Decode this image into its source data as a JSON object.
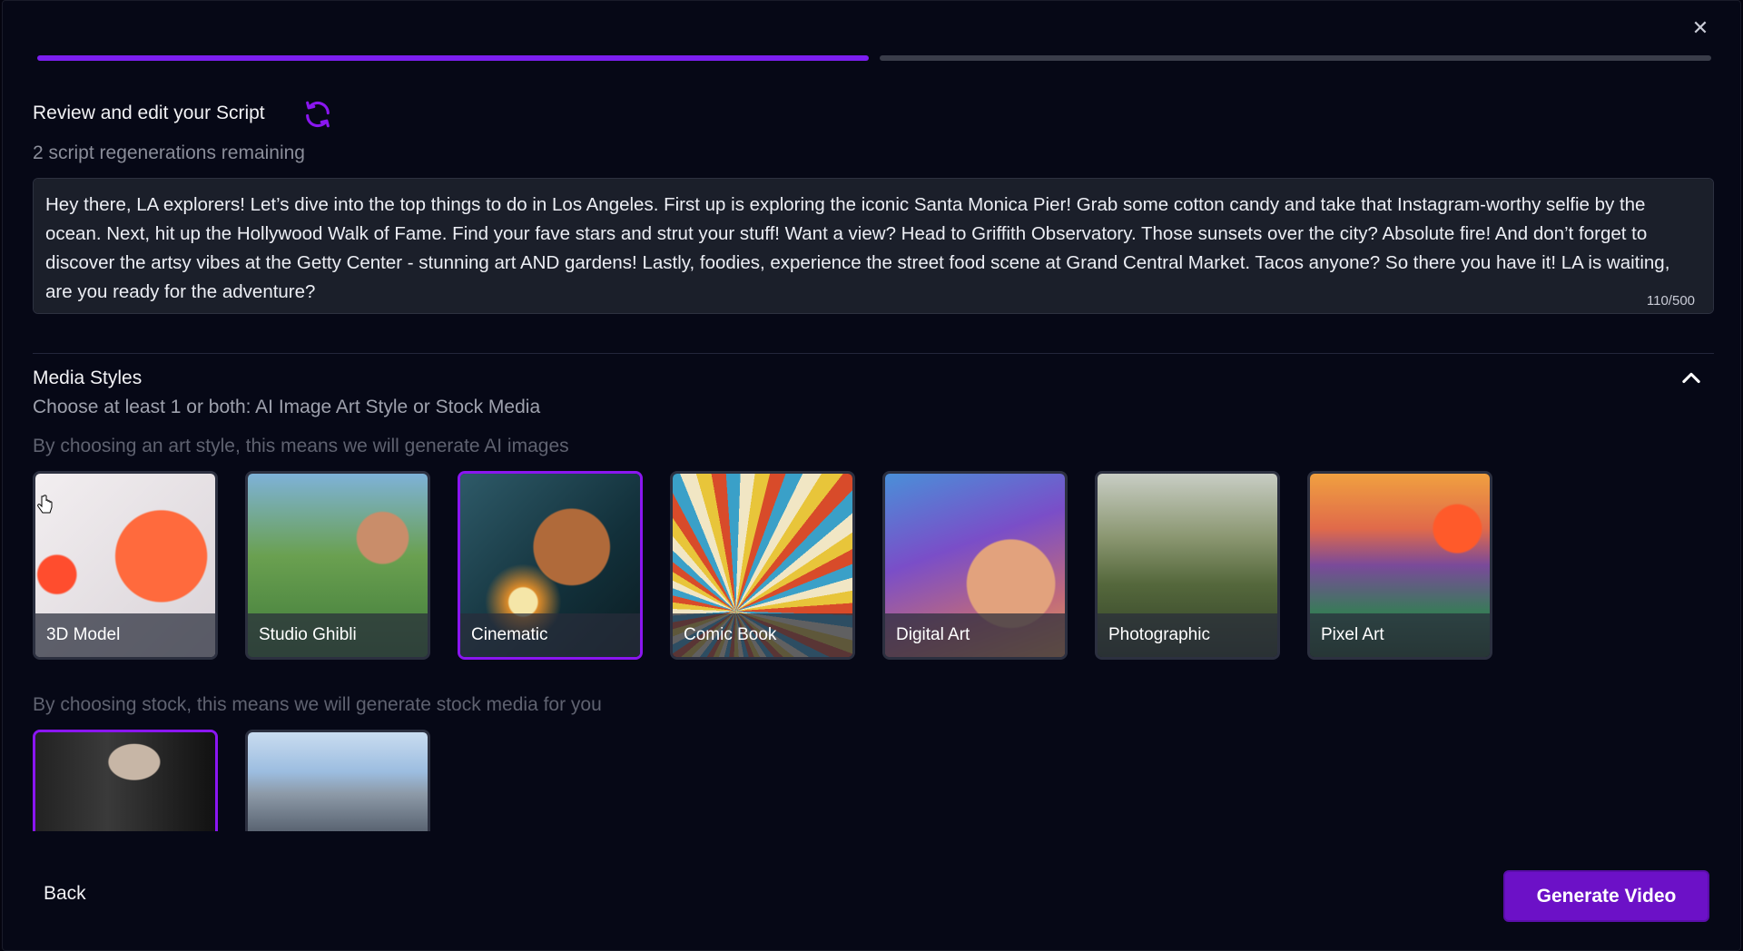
{
  "dialog": {
    "close_icon": "close-icon"
  },
  "progress": {
    "steps_total": 2,
    "current_step": 1
  },
  "script": {
    "title": "Review and edit your Script",
    "regenerate_icon": "refresh-icon",
    "remaining": "2 script regenerations remaining",
    "text": "Hey there, LA explorers! Let’s dive into the top things to do in Los Angeles. First up is exploring the iconic Santa Monica Pier! Grab some cotton candy and take that Instagram-worthy selfie by the ocean. Next, hit up the Hollywood Walk of Fame. Find your fave stars and strut your stuff! Want a view? Head to Griffith Observatory. Those sunsets over the city? Absolute fire! And don’t forget to discover the artsy vibes at the Getty Center - stunning art AND gardens! Lastly, foodies, experience the street food scene at Grand Central Market. Tacos anyone? So there you have it! LA is waiting, are you ready for the adventure?",
    "counter": "110/500"
  },
  "media": {
    "title": "Media Styles",
    "subtitle": "Choose at least 1 or both: AI Image Art Style or Stock Media",
    "art_hint": "By choosing an art style, this means we will generate AI images",
    "stock_hint": "By choosing stock, this means we will generate stock media for you",
    "art_styles": [
      {
        "label": "3D Model",
        "selected": false
      },
      {
        "label": "Studio Ghibli",
        "selected": false
      },
      {
        "label": "Cinematic",
        "selected": true
      },
      {
        "label": "Comic Book",
        "selected": false
      },
      {
        "label": "Digital Art",
        "selected": false
      },
      {
        "label": "Photographic",
        "selected": false
      },
      {
        "label": "Pixel Art",
        "selected": false
      }
    ],
    "stock": [
      {
        "name": "stock-video",
        "selected": true
      },
      {
        "name": "stock-image",
        "selected": false
      }
    ]
  },
  "footer": {
    "back_label": "Back",
    "generate_label": "Generate Video"
  },
  "colors": {
    "accent": "#7c1ff0",
    "button": "#6c11c7",
    "background": "#060816"
  }
}
